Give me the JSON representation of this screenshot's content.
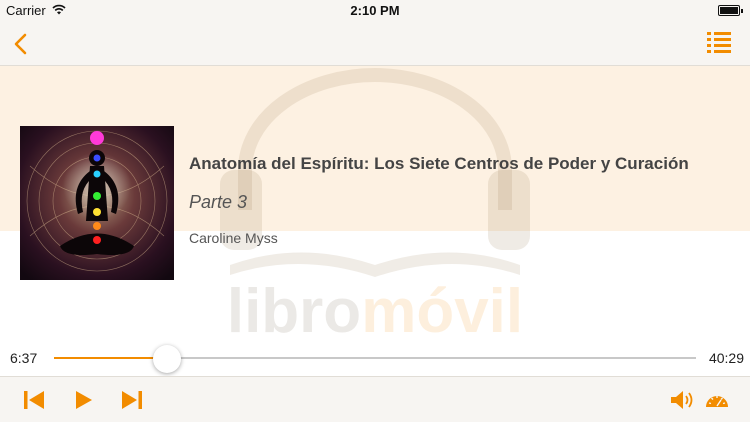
{
  "status_bar": {
    "carrier": "Carrier",
    "time": "2:10 PM"
  },
  "nav": {
    "back_icon": "chevron-left-icon",
    "list_icon": "chapter-list-icon"
  },
  "book": {
    "title": "Anatomía del Espíritu: Los Siete Centros de Poder y Curación",
    "part": "Parte 3",
    "author": "Caroline Myss"
  },
  "watermark": {
    "text_libro": "libro",
    "text_movil": "móvil"
  },
  "player": {
    "elapsed": "6:37",
    "remaining": "40:29",
    "progress": 0.176
  },
  "toolbar": {
    "icons": [
      "skip-back-icon",
      "play-icon",
      "skip-forward-icon",
      "volume-icon",
      "speed-gauge-icon"
    ]
  },
  "colors": {
    "accent": "#f28c00",
    "bar_bg": "#f7f5f2",
    "hero_bg": "#fdf1e2"
  }
}
